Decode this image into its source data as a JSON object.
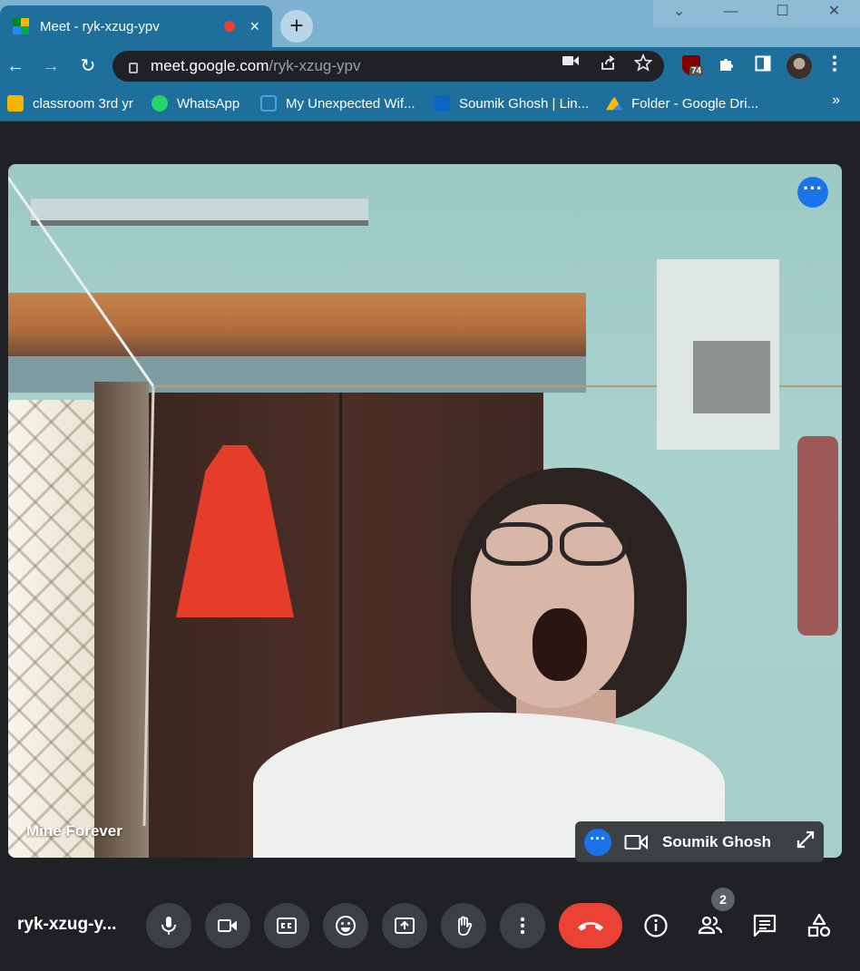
{
  "browser": {
    "tab": {
      "title": "Meet - ryk-xzug-ypv",
      "favicon": "google-meet-icon",
      "recording_indicator": "red-dot",
      "close": "×"
    },
    "new_tab_label": "+",
    "window_controls": {
      "collapse": "⌄",
      "minimize": "—",
      "maximize": "☐",
      "close": "✕"
    },
    "nav": {
      "back": "←",
      "forward": "→",
      "reload": "↻"
    },
    "address": {
      "host": "meet.google.com",
      "path": "/ryk-xzug-ypv"
    },
    "extensions": {
      "ublock_badge": "74"
    },
    "bookmarks": [
      {
        "label": "classroom 3rd yr",
        "icon": "google-classroom-icon",
        "color": "#f4b400"
      },
      {
        "label": "WhatsApp",
        "icon": "whatsapp-icon",
        "color": "#25d366"
      },
      {
        "label": "My Unexpected Wif...",
        "icon": "webpage-icon",
        "color": "#4aa3df"
      },
      {
        "label": "Soumik Ghosh | Lin...",
        "icon": "linkedin-icon",
        "color": "#0a66c2"
      },
      {
        "label": "Folder - Google Dri...",
        "icon": "google-drive-icon",
        "color": "#fbbc04"
      }
    ],
    "bookmarks_more": "»"
  },
  "meet": {
    "main_participant": {
      "name": "Mine Forever"
    },
    "self_view": {
      "name": "Soumik Ghosh"
    },
    "meeting_code": "ryk-xzug-y...",
    "participants_count": "2",
    "colors": {
      "accent": "#1a73e8",
      "hangup": "#ea4335",
      "control_bg": "#3c4043",
      "background": "#202124"
    }
  }
}
